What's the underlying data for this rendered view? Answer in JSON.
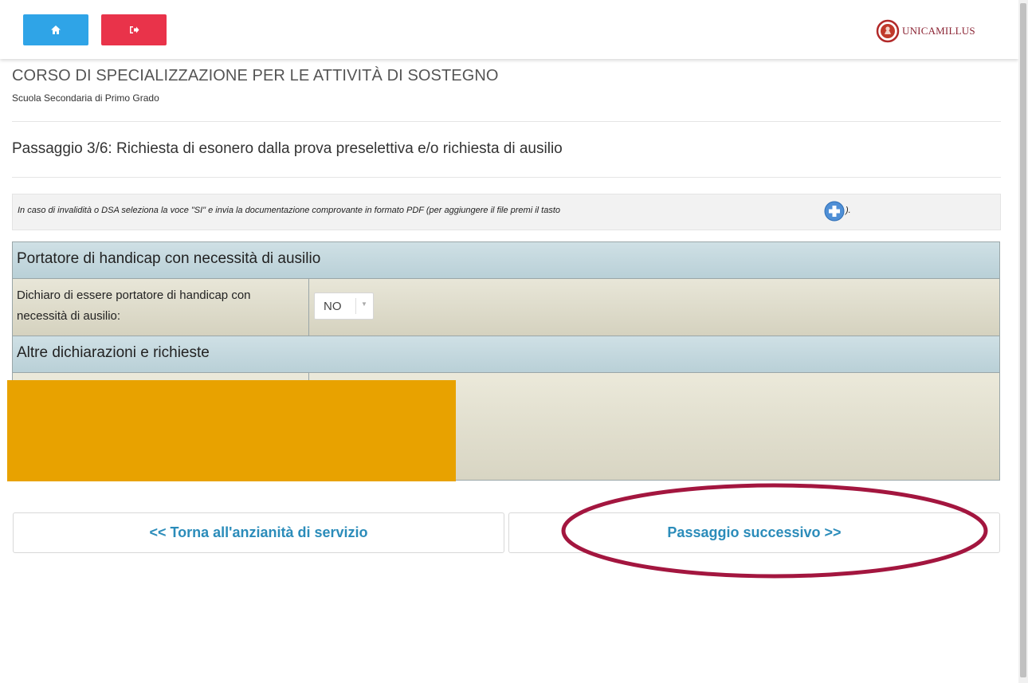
{
  "header": {
    "home_icon": "home-icon",
    "logout_icon": "logout-icon",
    "logo_text": "UNICAMILLUS",
    "colors": {
      "home_button": "#2fa4e7",
      "logout_button": "#e9334a"
    }
  },
  "page": {
    "course_title": "CORSO DI SPECIALIZZAZIONE PER LE ATTIVITÀ DI SOSTEGNO",
    "course_subtitle": "Scuola Secondaria di Primo Grado",
    "step_title": "Passaggio 3/6: Richiesta di esonero dalla prova preselettiva e/o richiesta di ausilio"
  },
  "info": {
    "text": "In caso di invalidità o DSA seleziona la voce \"SI\" e invia la documentazione comprovante in formato PDF (per aggiungere il file premi il tasto",
    "text_end": ").",
    "icon": "plus-circle-icon"
  },
  "form": {
    "section1_title": "Portatore di handicap con necessità di ausilio",
    "row1_label": "Dichiaro di essere portatore di handicap con necessità di ausilio:",
    "row1_select_value": "NO",
    "section2_title": "Altre dichiarazioni e richieste"
  },
  "nav": {
    "back_label": "<< Torna all'anzianità di servizio",
    "next_label": "Passaggio successivo >>"
  }
}
